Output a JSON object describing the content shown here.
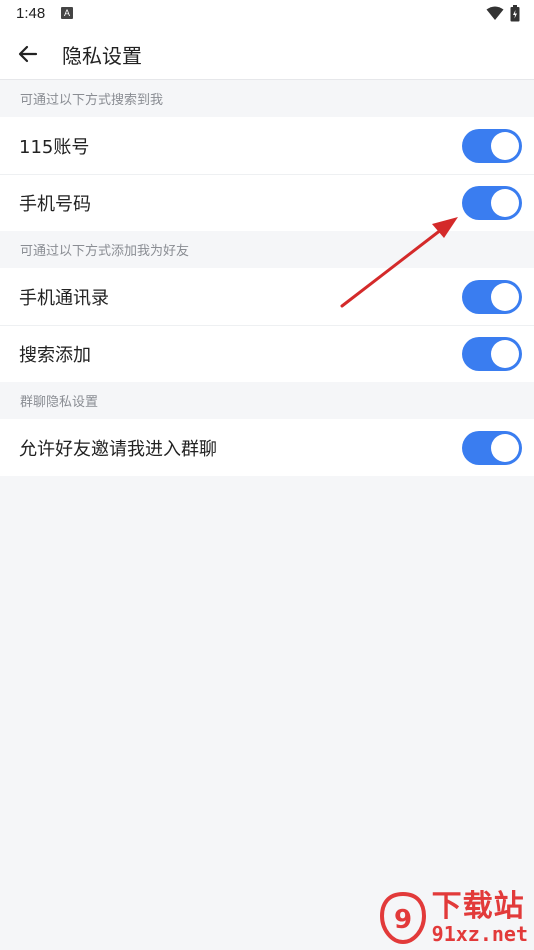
{
  "status_bar": {
    "time": "1:48",
    "notif_icon": "A"
  },
  "app_bar": {
    "title": "隐私设置"
  },
  "sections": [
    {
      "header": "可通过以下方式搜索到我",
      "items": [
        {
          "label": "115账号",
          "enabled": true
        },
        {
          "label": "手机号码",
          "enabled": true
        }
      ]
    },
    {
      "header": "可通过以下方式添加我为好友",
      "items": [
        {
          "label": "手机通讯录",
          "enabled": true
        },
        {
          "label": "搜索添加",
          "enabled": true
        }
      ]
    },
    {
      "header": "群聊隐私设置",
      "items": [
        {
          "label": "允许好友邀请我进入群聊",
          "enabled": true
        }
      ]
    }
  ],
  "watermark": {
    "title": "下载站",
    "site": "91xz.net"
  },
  "colors": {
    "accent": "#3a7df0",
    "arrow": "#d42a2a",
    "watermark": "#e23a3a"
  }
}
